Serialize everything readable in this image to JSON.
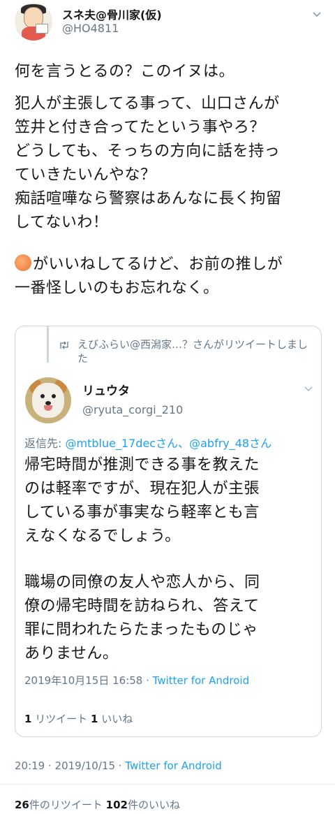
{
  "author": {
    "name": "スネ夫@骨川家(仮)",
    "handle": "@HO4811"
  },
  "tweet": {
    "line1": "何を言うとるの？このイヌは。",
    "body_lines": [
      "犯人が主張してる事って、山口さんが",
      "笠井と付き合ってたという事やろ？",
      "どうしても、そっちの方向に話を持っ",
      "ていきたいんやな？",
      "痴話喧嘩なら警察はあんなに長く拘留",
      "してないわ！"
    ],
    "last_line1": "がいいねしてるけど、お前の推しが",
    "last_line2": "一番怪しいのもお忘れなく。"
  },
  "quoted": {
    "retweet_text": "えびふらい@西潟家…？さんがリツイートしました",
    "name": "リュウタ",
    "handle": "@ryuta_corgi_210",
    "reply_prefix": "返信先: ",
    "mention1": "@mtblue_17decさん",
    "separator": "、",
    "mention2": "@abfry_48さん",
    "para1": [
      "帰宅時間が推測できる事を教えた",
      "のは軽率ですが、現在犯人が主張",
      "している事が事実なら軽率とも言",
      "えなくなるでしょう。"
    ],
    "para2": [
      "職場の同僚の友人や恋人から、同",
      "僚の帰宅時間を訪ねられ、答えて",
      "罪に問われたらたまったものじゃ",
      "ありません。"
    ],
    "timestamp": "2019年10月15日 16:58 · ",
    "source": "Twitter for Android",
    "retweet_count": "1",
    "retweet_label": " リツイート  ",
    "like_count": "1",
    "like_label": " いいね"
  },
  "meta": {
    "timestamp": "20:19 · 2019/10/15 · ",
    "source": "Twitter for Android",
    "retweet_count": "26",
    "retweet_label": "件のリツイート  ",
    "like_count": "102",
    "like_label": "件のいいね"
  },
  "icons": [
    "caret-down-icon",
    "retweet-icon",
    "emoji-icon"
  ]
}
